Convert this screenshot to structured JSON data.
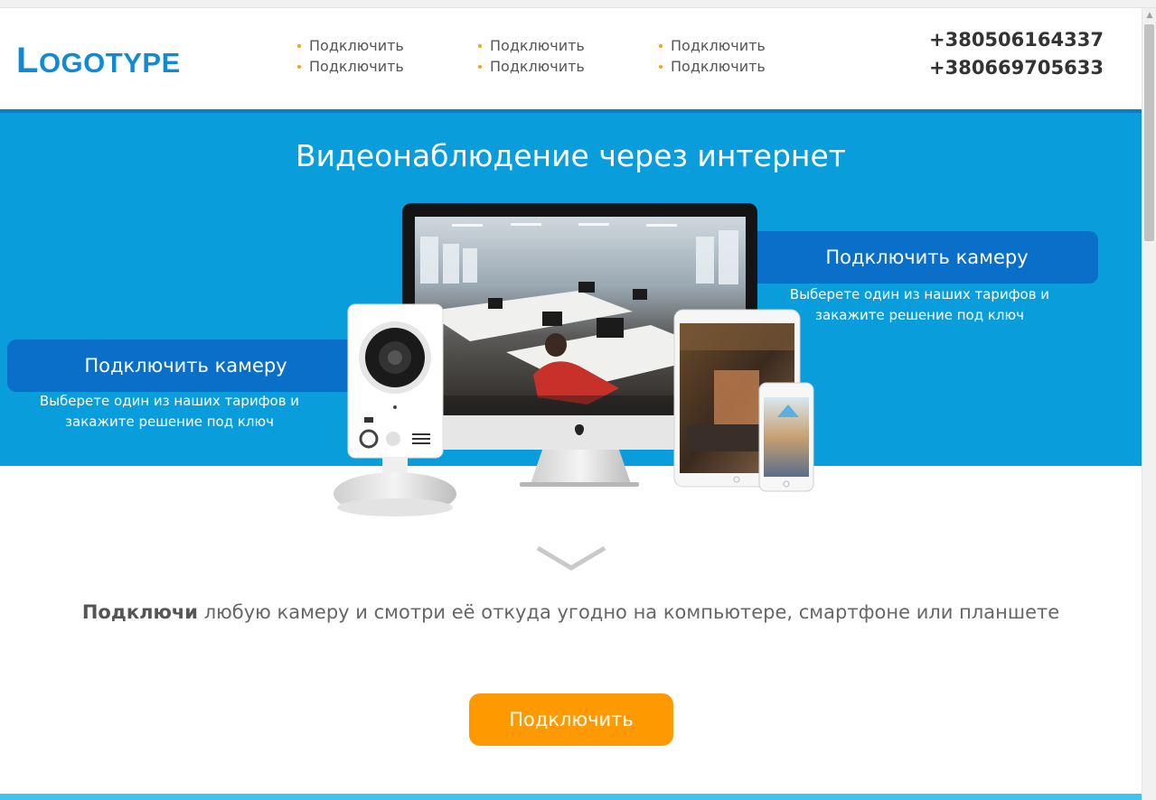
{
  "header": {
    "logo_initial": "L",
    "logo_rest": "OGOTYPE",
    "nav_columns": [
      [
        "Подключить",
        "Подключить"
      ],
      [
        "Подключить",
        "Подключить"
      ],
      [
        "Подключить",
        "Подключить"
      ]
    ],
    "phones": [
      "+380506164337",
      "+380669705633"
    ]
  },
  "hero": {
    "title": "Видеонаблюдение через интернет",
    "left_cta": {
      "label": "Подключить камеру",
      "description": "Выберете один из наших тарифов и закажите решение под ключ"
    },
    "right_cta": {
      "label": "Подключить камеру",
      "description": "Выберете один из наших тарифов и закажите решение под ключ"
    }
  },
  "main": {
    "tagline_bold": "Подключи",
    "tagline_rest": " любую камеру и смотри её откуда угодно на компьютере, смартфоне или планшете",
    "cta_label": "Подключить"
  },
  "colors": {
    "accent_blue": "#0a9ddb",
    "pill_blue": "#0a6fc9",
    "logo_blue": "#0f8bd6",
    "orange": "#ff9900",
    "bullet_orange": "#f5a022"
  },
  "icons": [
    "chevron-down-icon",
    "apple-logo-icon",
    "scroll-up-arrow-icon"
  ]
}
